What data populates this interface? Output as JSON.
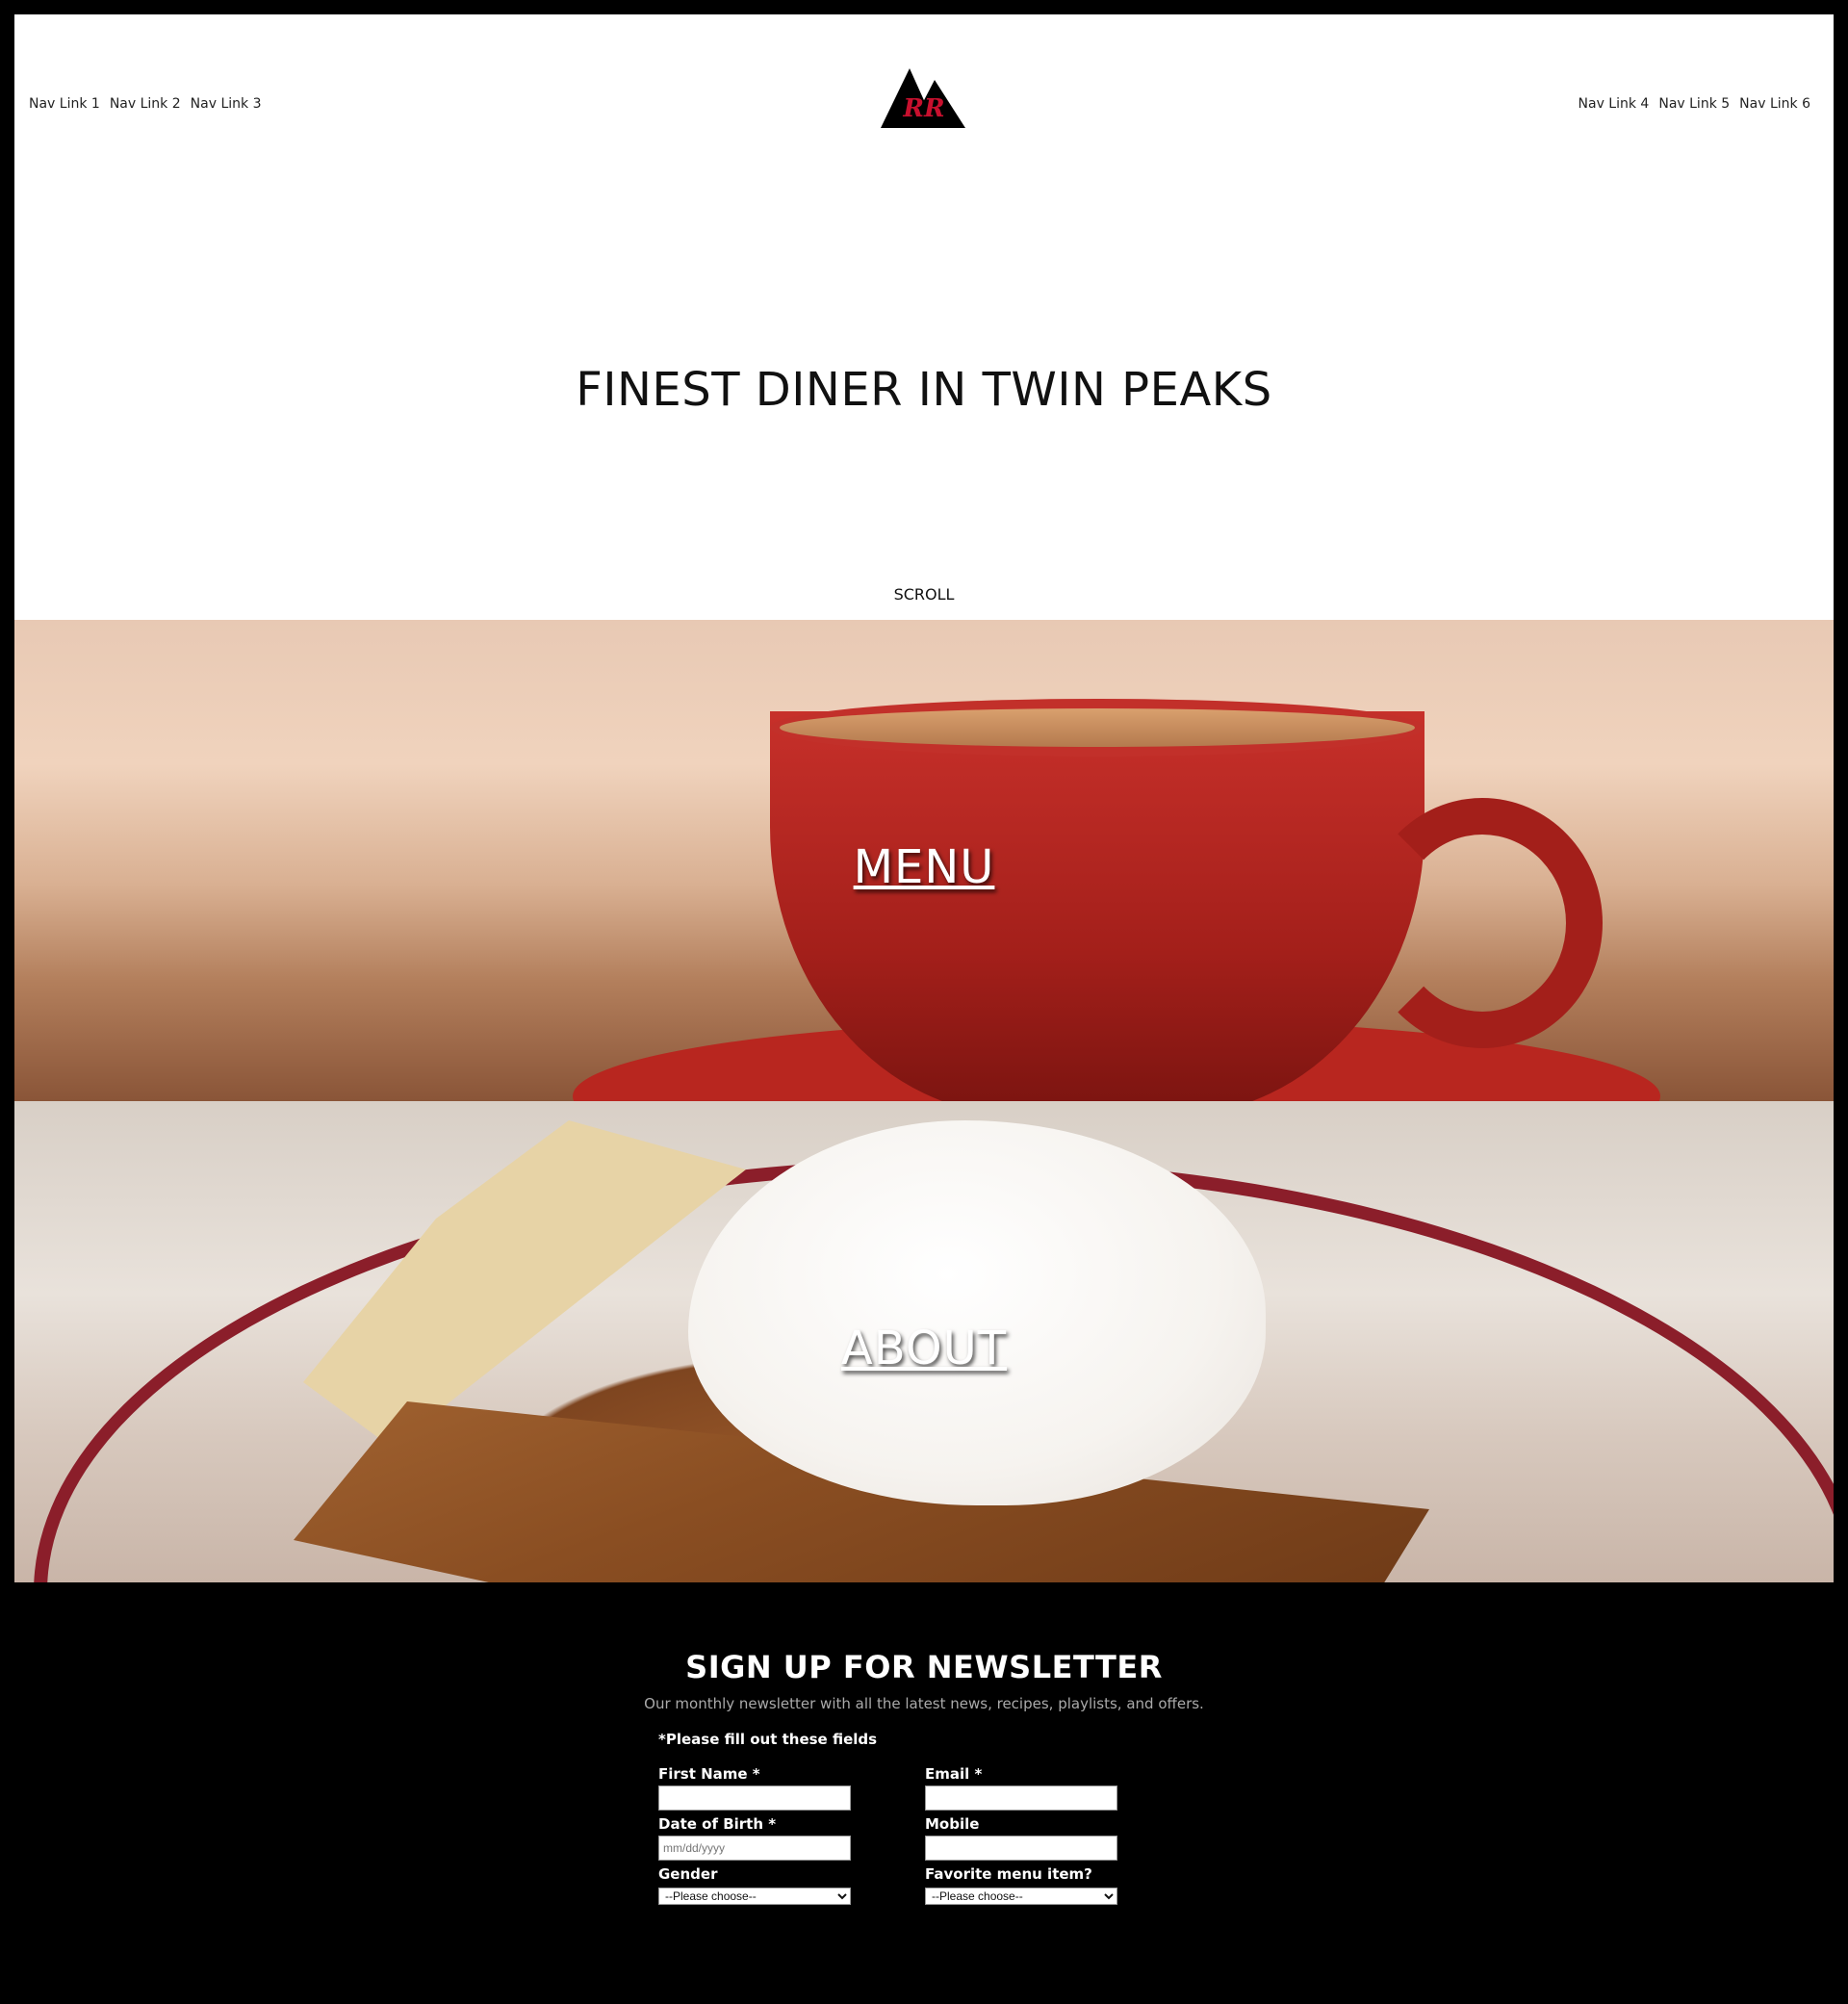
{
  "nav": {
    "left": [
      "Nav Link 1",
      "Nav Link 2",
      "Nav Link 3"
    ],
    "right": [
      "Nav Link 4",
      "Nav Link 5",
      "Nav Link 6"
    ]
  },
  "logo": {
    "text": "RR"
  },
  "hero": {
    "title": "FINEST DINER IN TWIN PEAKS",
    "scroll_label": "SCROLL"
  },
  "panels": {
    "menu_label": "MENU",
    "about_label": "ABOUT"
  },
  "newsletter": {
    "title": "SIGN UP FOR NEWSLETTER",
    "subtitle": "Our monthly newsletter with all the latest news, recipes, playlists, and offers.",
    "required_note": "*Please fill out these fields",
    "fields": {
      "first_name": {
        "label": "First Name *",
        "value": ""
      },
      "email": {
        "label": "Email *",
        "value": ""
      },
      "dob": {
        "label": "Date of Birth *",
        "placeholder": "mm/dd/yyyy"
      },
      "mobile": {
        "label": "Mobile",
        "value": ""
      },
      "gender": {
        "label": "Gender",
        "selected": "--Please choose--"
      },
      "favorite": {
        "label": "Favorite menu item?",
        "selected": "--Please choose--"
      }
    }
  },
  "colors": {
    "background": "#000000",
    "header_bg": "#ffffff",
    "logo_red": "#c8102e"
  }
}
